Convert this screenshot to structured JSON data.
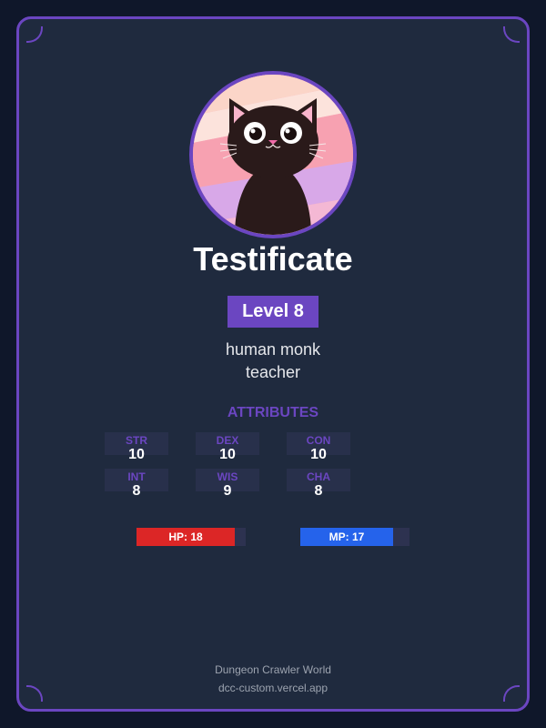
{
  "character": {
    "name": "Testificate",
    "level_label": "Level 8",
    "race_class": "human monk",
    "background": "teacher",
    "portrait": "black-cat-avatar"
  },
  "attributes": {
    "heading": "ATTRIBUTES",
    "items": [
      {
        "label": "STR",
        "value": "10"
      },
      {
        "label": "DEX",
        "value": "10"
      },
      {
        "label": "CON",
        "value": "10"
      },
      {
        "label": "INT",
        "value": "8"
      },
      {
        "label": "WIS",
        "value": "9"
      },
      {
        "label": "CHA",
        "value": "8"
      }
    ]
  },
  "stats": {
    "hp": {
      "label": "HP: 18",
      "fill_fraction": 0.9,
      "color": "#dc2626"
    },
    "mp": {
      "label": "MP: 17",
      "fill_fraction": 0.85,
      "color": "#2563eb"
    }
  },
  "footer": {
    "site_name": "Dungeon Crawler World",
    "url": "dcc-custom.vercel.app"
  },
  "theme": {
    "accent": "#6b46c1",
    "card_bg": "#1f2a3e",
    "page_bg": "#0f172a"
  }
}
